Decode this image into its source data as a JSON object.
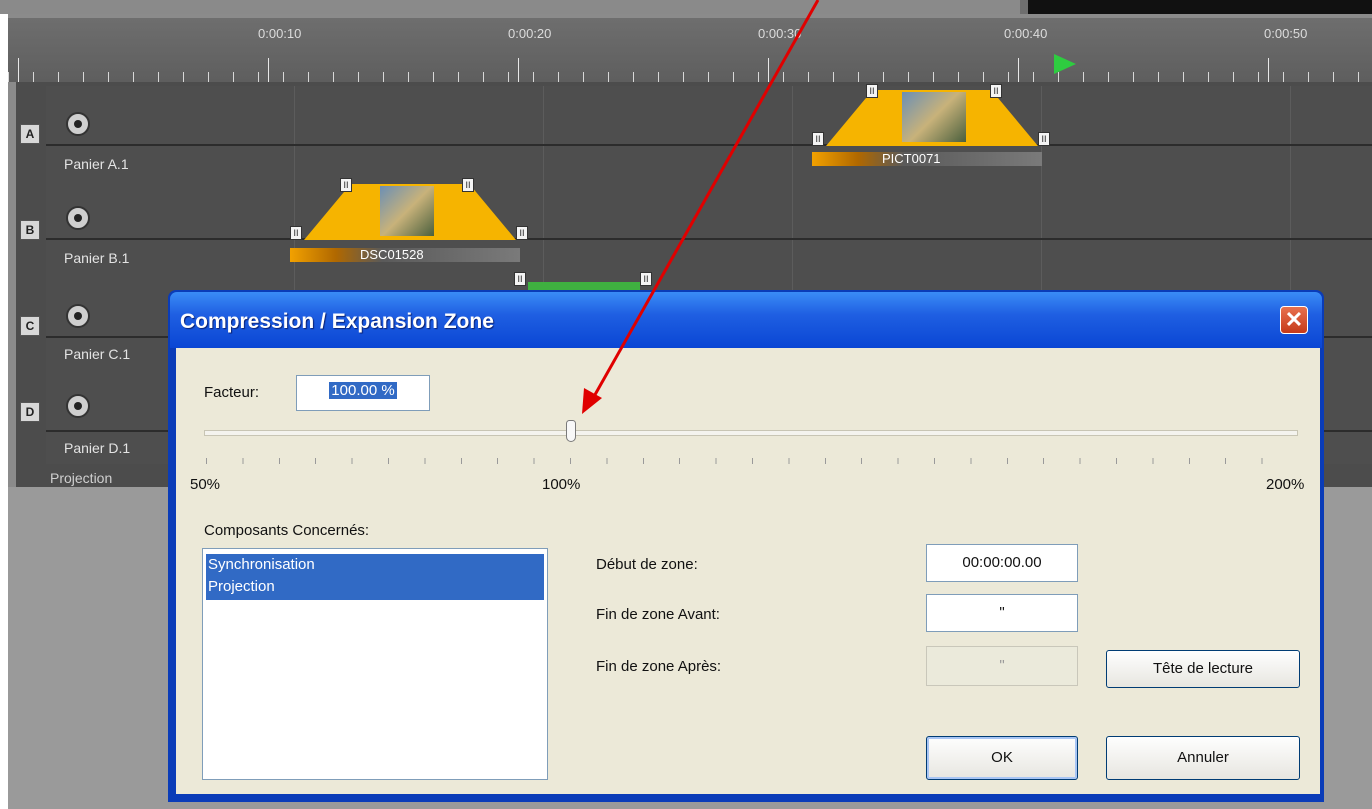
{
  "timeline": {
    "timecodes": [
      "0:00:10",
      "0:00:20",
      "0:00:30",
      "0:00:40",
      "0:00:50"
    ],
    "lanes": [
      {
        "button": "A",
        "label": "Panier A.1"
      },
      {
        "button": "B",
        "label": "Panier B.1"
      },
      {
        "button": "C",
        "label": "Panier C.1"
      },
      {
        "button": "D",
        "label": "Panier D.1"
      }
    ],
    "projection_label": "Projection",
    "clips": [
      {
        "name": "PICT0071",
        "start_marker": "1"
      },
      {
        "name": "DSC01528",
        "start_marker": "1"
      }
    ]
  },
  "dialog": {
    "title": "Compression / Expansion Zone",
    "close_icon": "close-x-icon",
    "facteur_label": "Facteur:",
    "facteur_value": "100.00 %",
    "slider": {
      "min_label": "50%",
      "mid_label": "100%",
      "max_label": "200%",
      "value_percent": 100
    },
    "composants_label": "Composants Concernés:",
    "composants_items": [
      "Synchronisation",
      "Projection"
    ],
    "debut_label": "Début de zone:",
    "debut_value": "00:00:00.00",
    "fin_avant_label": "Fin de zone Avant:",
    "fin_avant_value": "\"",
    "fin_apres_label": "Fin de zone Après:",
    "fin_apres_value": "\"",
    "tete_button": "Tête de lecture",
    "ok_button": "OK",
    "cancel_button": "Annuler"
  },
  "colors": {
    "title_bar": "#0a46d4",
    "selection": "#316ac5",
    "clip": "#f6b400",
    "arrow": "#e00000"
  }
}
